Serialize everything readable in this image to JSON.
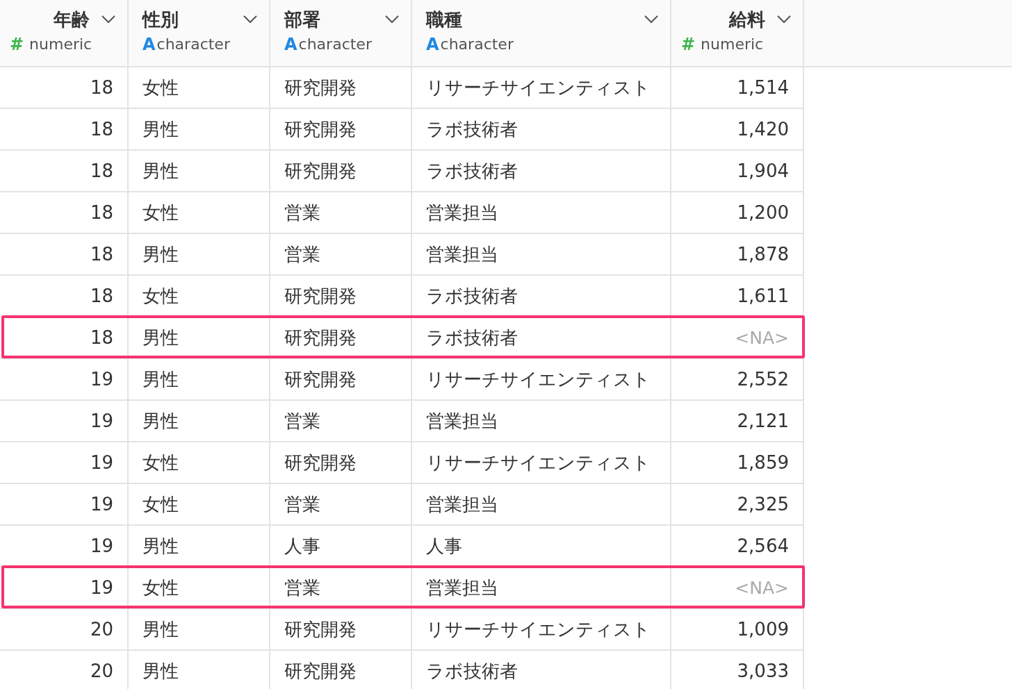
{
  "columns": [
    {
      "name": "年齢",
      "kind": "numeric",
      "type_icon": "#",
      "type": "numeric"
    },
    {
      "name": "性別",
      "kind": "character",
      "type_icon": "A",
      "type": "character"
    },
    {
      "name": "部署",
      "kind": "character",
      "type_icon": "A",
      "type": "character"
    },
    {
      "name": "職種",
      "kind": "character",
      "type_icon": "A",
      "type": "character"
    },
    {
      "name": "給料",
      "kind": "numeric",
      "type_icon": "#",
      "type": "numeric"
    }
  ],
  "rows": [
    {
      "cells": [
        "18",
        "女性",
        "研究開発",
        "リサーチサイエンティスト",
        "1,514"
      ],
      "salary_missing": false,
      "highlighted": false
    },
    {
      "cells": [
        "18",
        "男性",
        "研究開発",
        "ラボ技術者",
        "1,420"
      ],
      "salary_missing": false,
      "highlighted": false
    },
    {
      "cells": [
        "18",
        "男性",
        "研究開発",
        "ラボ技術者",
        "1,904"
      ],
      "salary_missing": false,
      "highlighted": false
    },
    {
      "cells": [
        "18",
        "女性",
        "営業",
        "営業担当",
        "1,200"
      ],
      "salary_missing": false,
      "highlighted": false
    },
    {
      "cells": [
        "18",
        "男性",
        "営業",
        "営業担当",
        "1,878"
      ],
      "salary_missing": false,
      "highlighted": false
    },
    {
      "cells": [
        "18",
        "女性",
        "研究開発",
        "ラボ技術者",
        "1,611"
      ],
      "salary_missing": false,
      "highlighted": false
    },
    {
      "cells": [
        "18",
        "男性",
        "研究開発",
        "ラボ技術者",
        "<NA>"
      ],
      "salary_missing": true,
      "highlighted": true
    },
    {
      "cells": [
        "19",
        "男性",
        "研究開発",
        "リサーチサイエンティスト",
        "2,552"
      ],
      "salary_missing": false,
      "highlighted": false
    },
    {
      "cells": [
        "19",
        "男性",
        "営業",
        "営業担当",
        "2,121"
      ],
      "salary_missing": false,
      "highlighted": false
    },
    {
      "cells": [
        "19",
        "女性",
        "研究開発",
        "リサーチサイエンティスト",
        "1,859"
      ],
      "salary_missing": false,
      "highlighted": false
    },
    {
      "cells": [
        "19",
        "女性",
        "営業",
        "営業担当",
        "2,325"
      ],
      "salary_missing": false,
      "highlighted": false
    },
    {
      "cells": [
        "19",
        "男性",
        "人事",
        "人事",
        "2,564"
      ],
      "salary_missing": false,
      "highlighted": false
    },
    {
      "cells": [
        "19",
        "女性",
        "営業",
        "営業担当",
        "<NA>"
      ],
      "salary_missing": true,
      "highlighted": true
    },
    {
      "cells": [
        "20",
        "男性",
        "研究開発",
        "リサーチサイエンティスト",
        "1,009"
      ],
      "salary_missing": false,
      "highlighted": false
    },
    {
      "cells": [
        "20",
        "男性",
        "研究開発",
        "ラボ技術者",
        "3,033"
      ],
      "salary_missing": false,
      "highlighted": false
    }
  ]
}
